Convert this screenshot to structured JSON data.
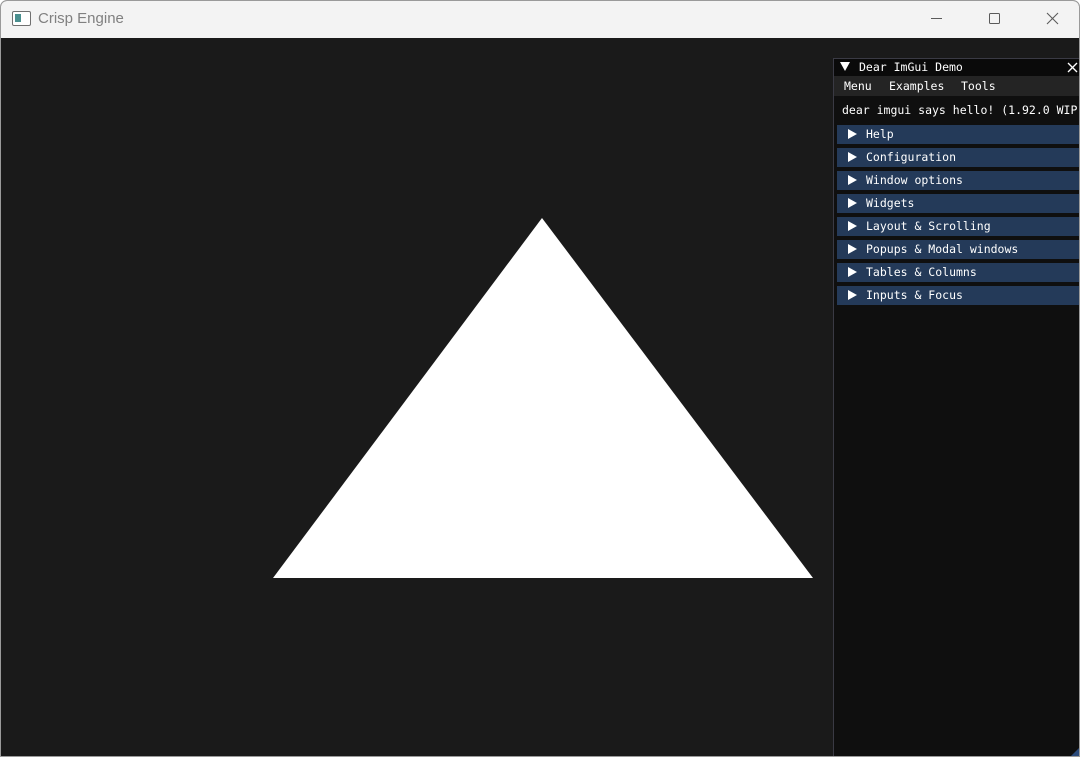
{
  "window": {
    "title": "Crisp Engine",
    "icon": "app-window-icon"
  },
  "caption": {
    "minimize_icon": "minimize-icon",
    "maximize_icon": "maximize-icon",
    "close_icon": "close-icon"
  },
  "scene": {
    "background_color": "#1a1a1a",
    "triangle_color": "#ffffff"
  },
  "imgui": {
    "title": "Dear ImGui Demo",
    "menu": [
      "Menu",
      "Examples",
      "Tools"
    ],
    "hello": "dear imgui says hello! (1.92.0 WIP",
    "headers": [
      "Help",
      "Configuration",
      "Window options",
      "Widgets",
      "Layout & Scrolling",
      "Popups & Modal windows",
      "Tables & Columns",
      "Inputs & Focus"
    ],
    "header_color": "#243a59",
    "window_bg": "#0f0f0f"
  }
}
